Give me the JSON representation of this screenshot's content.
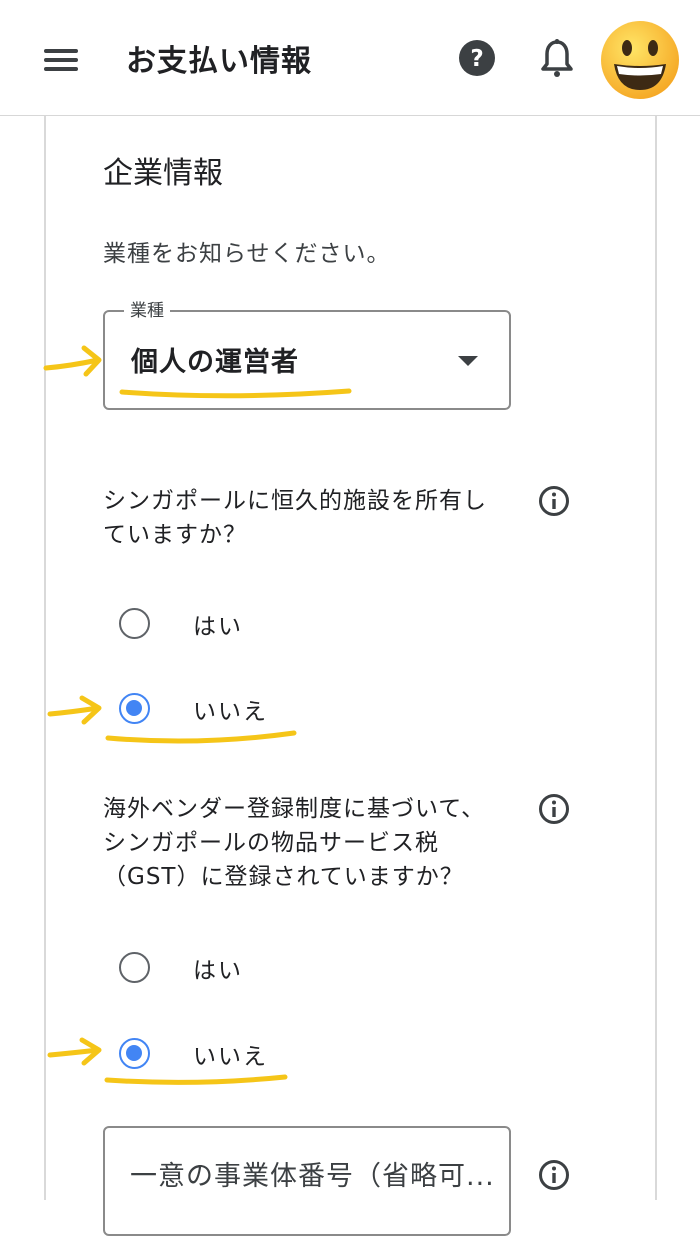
{
  "header": {
    "title": "お支払い情報"
  },
  "section": {
    "title": "企業情報",
    "prompt": "業種をお知らせください。"
  },
  "industry_select": {
    "label": "業種",
    "value": "個人の運営者"
  },
  "question1": {
    "line1": "シンガポールに恒久的施設を所有し",
    "line2": "ていますか？",
    "options": [
      "はい",
      "いいえ"
    ],
    "selected": "いいえ"
  },
  "question2": {
    "line1": "海外ベンダー登録制度に基づいて、",
    "line2": "シンガポールの物品サービス税",
    "line3": "（GST）に登録されていますか？",
    "options": [
      "はい",
      "いいえ"
    ],
    "selected": "いいえ"
  },
  "business_id_field": {
    "label": "一意の事業体番号（省略可..."
  },
  "colors": {
    "accent": "#4285f4",
    "annotation": "#f5c518",
    "text": "#202124"
  },
  "icons": [
    "menu-icon",
    "help-icon",
    "bell-icon",
    "avatar-emoji-icon",
    "info-icon",
    "dropdown-arrow-icon"
  ]
}
